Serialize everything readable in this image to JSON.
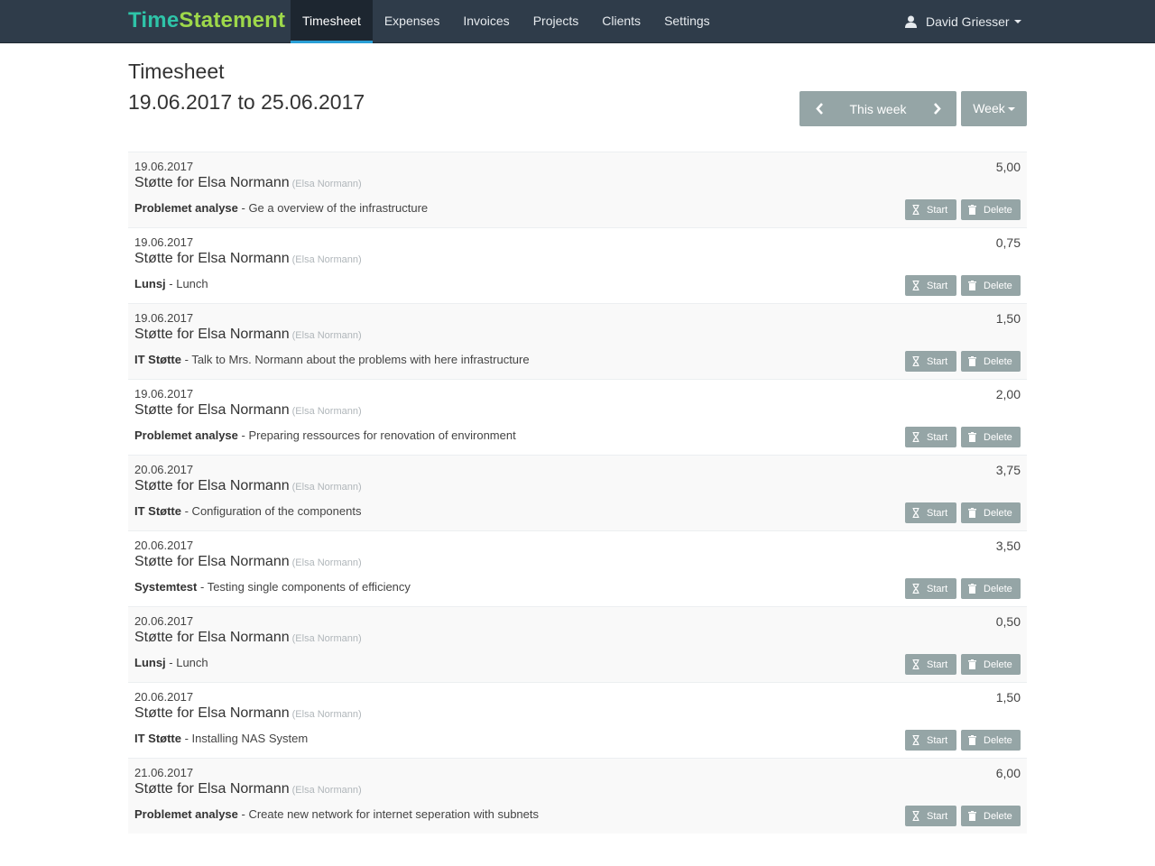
{
  "brand": {
    "part1": "Time",
    "part2": "Statement"
  },
  "nav": {
    "timesheet": "Timesheet",
    "expenses": "Expenses",
    "invoices": "Invoices",
    "projects": "Projects",
    "clients": "Clients",
    "settings": "Settings"
  },
  "user": {
    "name": "David Griesser",
    "icon": "user-icon"
  },
  "header": {
    "title": "Timesheet",
    "date_range": "19.06.2017 to 25.06.2017"
  },
  "week_nav": {
    "label": "This week",
    "period_button": "Week"
  },
  "actions": {
    "start": "Start",
    "delete": "Delete"
  },
  "entries": [
    {
      "date": "19.06.2017",
      "client": "Støtte for Elsa Normann",
      "contact": "(Elsa Normann)",
      "task": "Problemet analyse",
      "description": " - Ge a overview of the infrastructure",
      "hours": "5,00"
    },
    {
      "date": "19.06.2017",
      "client": "Støtte for Elsa Normann",
      "contact": "(Elsa Normann)",
      "task": "Lunsj",
      "description": " - Lunch",
      "hours": "0,75"
    },
    {
      "date": "19.06.2017",
      "client": "Støtte for Elsa Normann",
      "contact": "(Elsa Normann)",
      "task": "IT Støtte",
      "description": " - Talk to Mrs. Normann about the problems with here infrastructure",
      "hours": "1,50"
    },
    {
      "date": "19.06.2017",
      "client": "Støtte for Elsa Normann",
      "contact": "(Elsa Normann)",
      "task": "Problemet analyse",
      "description": " - Preparing ressources for renovation of environment",
      "hours": "2,00"
    },
    {
      "date": "20.06.2017",
      "client": "Støtte for Elsa Normann",
      "contact": "(Elsa Normann)",
      "task": "IT Støtte",
      "description": " - Configuration of the components",
      "hours": "3,75"
    },
    {
      "date": "20.06.2017",
      "client": "Støtte for Elsa Normann",
      "contact": "(Elsa Normann)",
      "task": "Systemtest",
      "description": " - Testing single components of efficiency",
      "hours": "3,50"
    },
    {
      "date": "20.06.2017",
      "client": "Støtte for Elsa Normann",
      "contact": "(Elsa Normann)",
      "task": "Lunsj",
      "description": " - Lunch",
      "hours": "0,50"
    },
    {
      "date": "20.06.2017",
      "client": "Støtte for Elsa Normann",
      "contact": "(Elsa Normann)",
      "task": "IT Støtte",
      "description": " - Installing NAS System",
      "hours": "1,50"
    },
    {
      "date": "21.06.2017",
      "client": "Støtte for Elsa Normann",
      "contact": "(Elsa Normann)",
      "task": "Problemet analyse",
      "description": " - Create new network for internet seperation with subnets",
      "hours": "6,00"
    }
  ],
  "colors": {
    "navbar": "#2f3c4a",
    "brand_time": "#2ec4a8",
    "brand_statement": "#9ed84a",
    "active_tab_underline": "#2a9fd6",
    "button": "#95a5a6"
  }
}
